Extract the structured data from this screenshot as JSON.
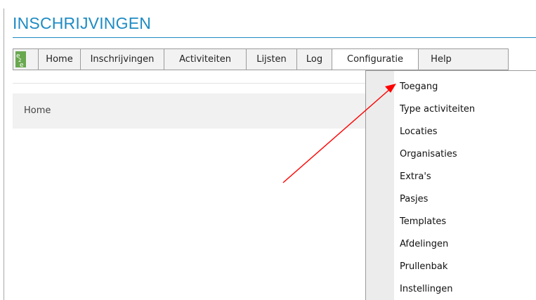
{
  "app": {
    "title": "INSCHRIJVINGEN",
    "logo_text": "e2e"
  },
  "nav": {
    "items": [
      {
        "label": "Home"
      },
      {
        "label": "Inschrijvingen"
      },
      {
        "label": "Activiteiten"
      },
      {
        "label": "Lijsten"
      },
      {
        "label": "Log"
      },
      {
        "label": "Configuratie"
      },
      {
        "label": "Help"
      }
    ],
    "active": "Configuratie"
  },
  "breadcrumb": {
    "label": "Home"
  },
  "dropdown": {
    "items": [
      {
        "label": "Toegang"
      },
      {
        "label": "Type activiteiten"
      },
      {
        "label": "Locaties"
      },
      {
        "label": "Organisaties"
      },
      {
        "label": "Extra's"
      },
      {
        "label": "Pasjes"
      },
      {
        "label": "Templates"
      },
      {
        "label": "Afdelingen"
      },
      {
        "label": "Prullenbak"
      },
      {
        "label": "Instellingen"
      }
    ]
  },
  "annotation": {
    "arrow_color": "#ff0000",
    "target": "Toegang"
  },
  "colors": {
    "brand": "#1e8bc3",
    "logo": "#6aa84f"
  }
}
